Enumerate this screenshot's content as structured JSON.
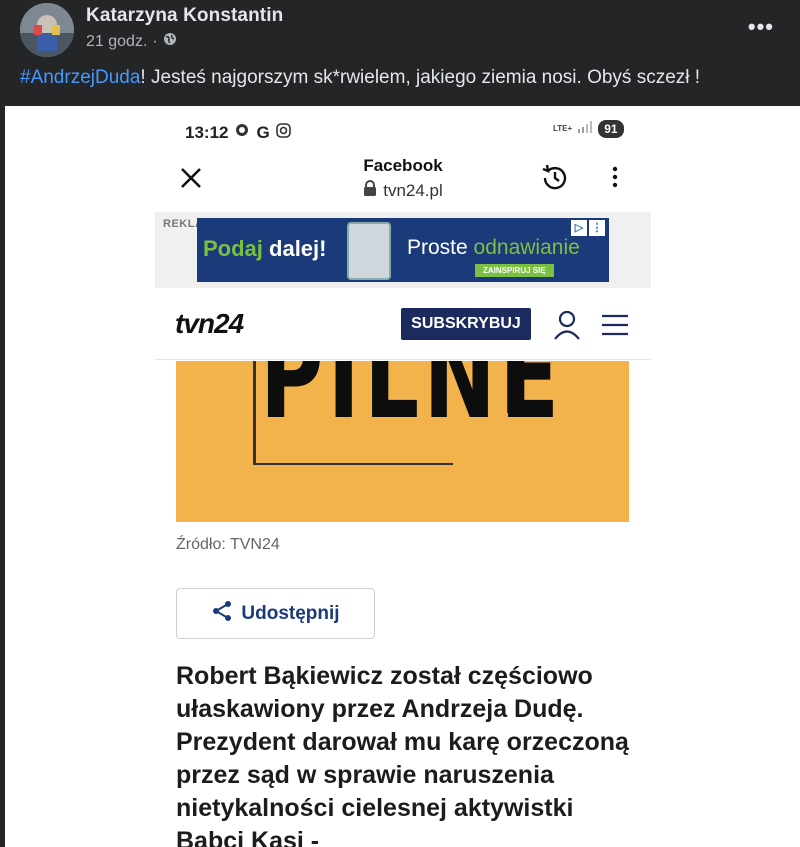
{
  "post": {
    "author": "Katarzyna Konstantin",
    "time": "21 godz.",
    "separator": "·",
    "more": "•••",
    "hashtag": "#AndrzejDuda",
    "text": "! Jesteś najgorszym sk*rwielem, jakiego ziemia nosi. Obyś sczezł !"
  },
  "phone": {
    "time": "13:12",
    "google_letter": "G",
    "network": "LTE+",
    "battery": "91"
  },
  "browser": {
    "title": "Facebook",
    "url": "tvn24.pl"
  },
  "ad": {
    "label": "REKLAMA",
    "left_a": "Podaj",
    "left_b": " dalej!",
    "right_a": "Proste ",
    "right_b": "odnawianie",
    "cta": "ZAINSPIRUJ SIĘ"
  },
  "site": {
    "logo": "tvn24",
    "subscribe": "SUBSKRYBUJ"
  },
  "hero": {
    "word": "PILNE"
  },
  "article": {
    "source": "Źródło: TVN24",
    "share": "Udostępnij",
    "headline": "Robert Bąkiewicz został częściowo ułaskawiony przez Andrzeja Dudę. Prezydent darował mu karę orzeczoną przez sąd w sprawie naruszenia nietykalności cielesnej aktywistki Babci Kasi -"
  },
  "colors": {
    "facebook_bg": "#242526",
    "hashtag": "#4599ff",
    "hero_bg": "#f2b24c",
    "brand_navy": "#1b2b5e"
  }
}
